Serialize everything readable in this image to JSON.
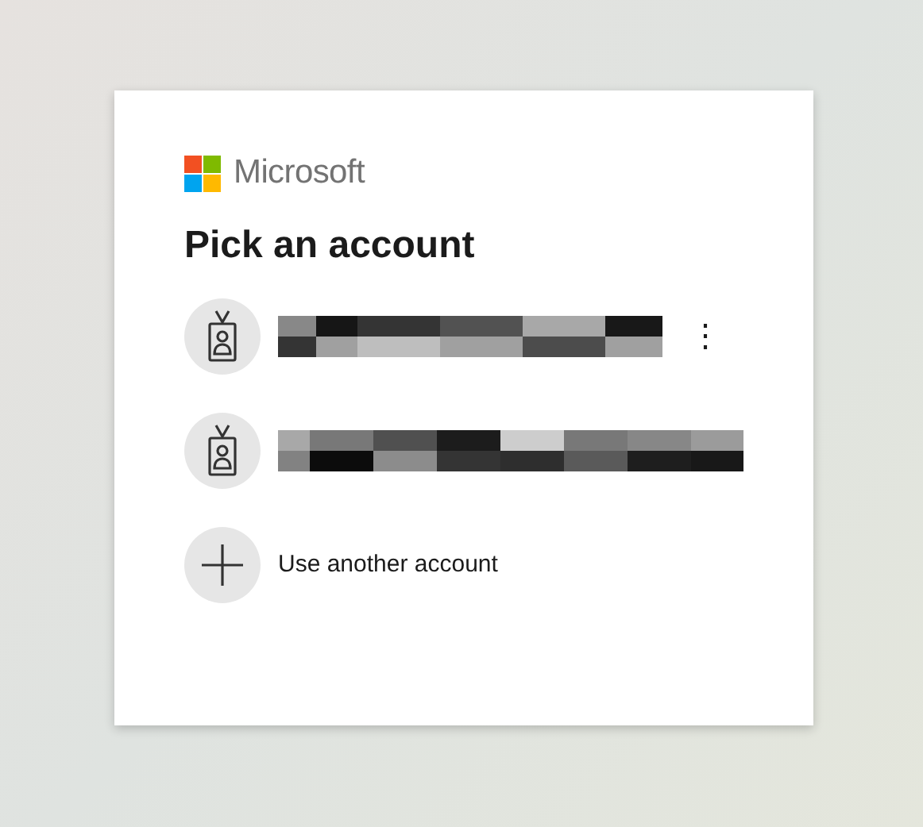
{
  "brand": {
    "name": "Microsoft"
  },
  "title": "Pick an account",
  "accounts": [
    {
      "kind": "redacted",
      "menu": "⋮"
    },
    {
      "kind": "redacted"
    }
  ],
  "other_account": {
    "label": "Use another account"
  }
}
